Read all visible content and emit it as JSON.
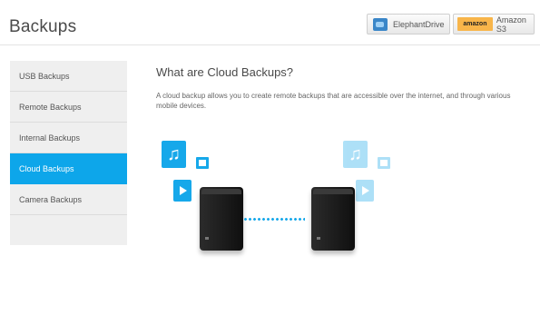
{
  "header": {
    "title": "Backups",
    "providers": [
      {
        "label": "ElephantDrive",
        "icon": "elephantdrive-logo-icon"
      },
      {
        "label": "Amazon S3",
        "icon": "amazon-web-services-logo-icon",
        "logo_text": "amazon"
      }
    ]
  },
  "sidebar": {
    "items": [
      {
        "label": "USB Backups"
      },
      {
        "label": "Remote Backups"
      },
      {
        "label": "Internal Backups"
      },
      {
        "label": "Cloud Backups",
        "active": true
      },
      {
        "label": "Camera Backups"
      }
    ]
  },
  "main": {
    "title": "What are Cloud Backups?",
    "description": "A cloud backup allows you to create remote backups that are accessible over the internet, and through various mobile devices."
  },
  "illustration": {
    "icons": [
      "music-icon",
      "photo-icon",
      "video-icon",
      "nas-device-icon",
      "transfer-dots"
    ],
    "accent": "#16a8ea",
    "active_nav": "#0da6ea"
  }
}
